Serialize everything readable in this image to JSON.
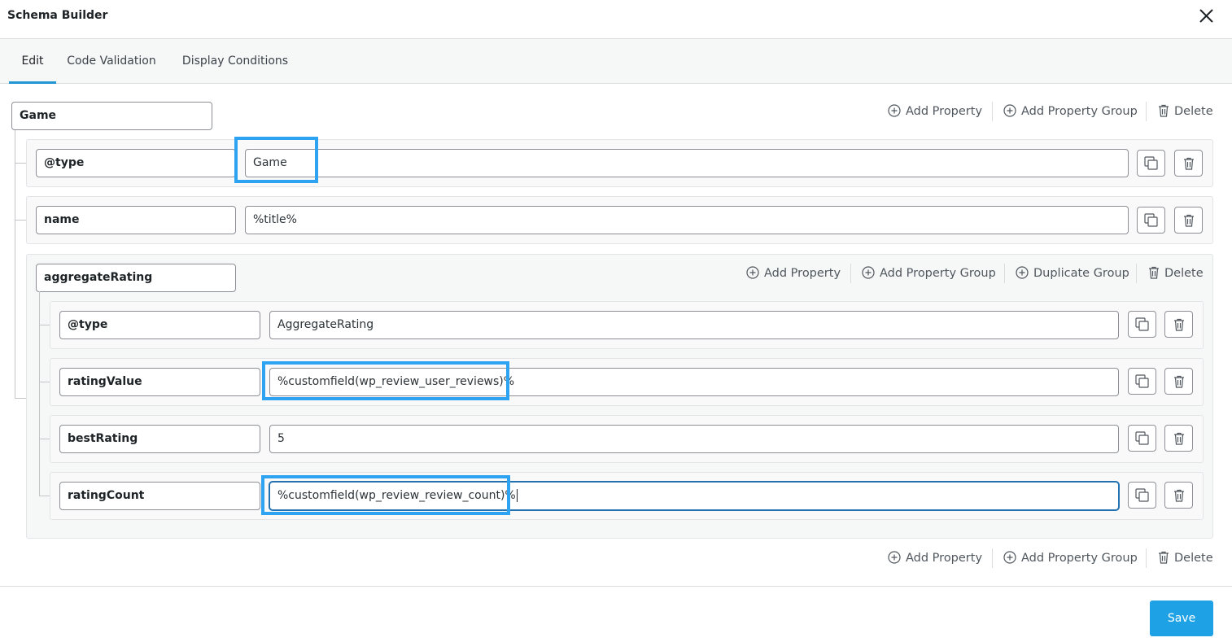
{
  "modal": {
    "title": "Schema Builder"
  },
  "tabs": [
    {
      "label": "Edit",
      "active": true
    },
    {
      "label": "Code Validation",
      "active": false
    },
    {
      "label": "Display Conditions",
      "active": false
    }
  ],
  "root": {
    "name": "Game",
    "actions": {
      "add_property": "Add Property",
      "add_group": "Add Property Group",
      "delete": "Delete"
    },
    "properties": [
      {
        "key": "@type",
        "value": "Game"
      },
      {
        "key": "name",
        "value": "%title%"
      }
    ],
    "group": {
      "name": "aggregateRating",
      "actions": {
        "add_property": "Add Property",
        "add_group": "Add Property Group",
        "duplicate": "Duplicate Group",
        "delete": "Delete"
      },
      "properties": [
        {
          "key": "@type",
          "value": "AggregateRating"
        },
        {
          "key": "ratingValue",
          "value": "%customfield(wp_review_user_reviews)%"
        },
        {
          "key": "bestRating",
          "value": "5"
        },
        {
          "key": "ratingCount",
          "value": "%customfield(wp_review_review_count)%"
        }
      ]
    },
    "bottom_actions": {
      "add_property": "Add Property",
      "add_group": "Add Property Group",
      "delete": "Delete"
    }
  },
  "footer": {
    "save_label": "Save"
  },
  "colors": {
    "accent": "#2196d3",
    "highlight": "#2ea3f2",
    "save": "#1fa1e6"
  }
}
